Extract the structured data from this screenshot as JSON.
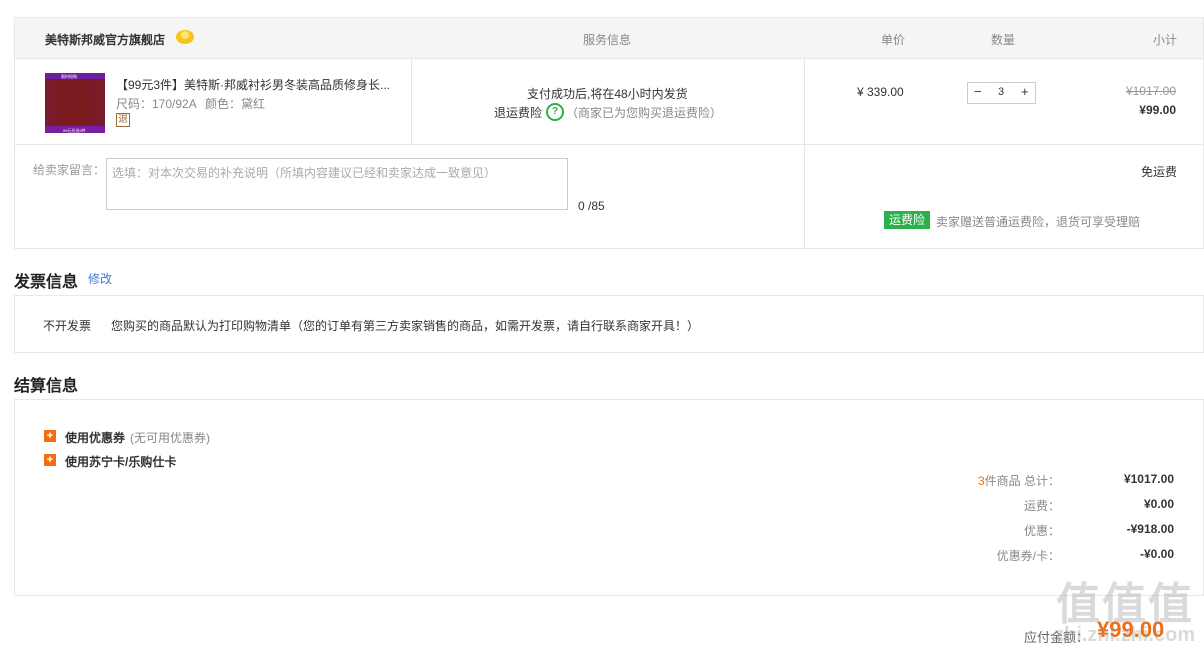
{
  "table_header": {
    "store": "美特斯邦威官方旗舰店",
    "service": "服务信息",
    "unit_price": "单价",
    "quantity": "数量",
    "subtotal": "小计"
  },
  "item": {
    "title": "【99元3件】美特斯·邦威衬衫男冬装高品质修身长...",
    "size": "尺码：170/92A",
    "color": "颜色：黛红",
    "return_tag": "退",
    "thumb_top": "限时抢购",
    "thumb_bottom": "99元任选3件",
    "service_line1": "支付成功后,将在48小时内发货",
    "service_insurance_label": "退运费险",
    "service_insurance_note": "（商家已为您购买退运费险）",
    "unit_price": "¥ 339.00",
    "quantity": "3",
    "original_subtotal": "¥1017.00",
    "subtotal": "¥99.00"
  },
  "message": {
    "label": "给卖家留言：",
    "placeholder": "选填：对本次交易的补充说明（所填内容建议已经和卖家达成一致意见）",
    "counter": "0 /85"
  },
  "shipping": {
    "free": "免运费",
    "badge": "运费险",
    "note": "卖家赠送普通运费险，退货可享受理赔"
  },
  "invoice": {
    "title": "发票信息",
    "edit_link": "修改",
    "type": "不开发票",
    "note": "您购买的商品默认为打印购物清单（您的订单有第三方卖家销售的商品，如需开发票，请自行联系商家开具！）"
  },
  "settlement": {
    "title": "结算信息",
    "coupon_label": "使用优惠券",
    "coupon_note": "(无可用优惠券)",
    "card_label": "使用苏宁卡/乐购仕卡",
    "rows": [
      {
        "count": "3",
        "label": "件商品 总计：",
        "value": "¥1017.00"
      },
      {
        "label": "运费：",
        "value": "¥0.00"
      },
      {
        "label": "优惠：",
        "value": "-¥918.00"
      },
      {
        "label": "优惠券/卡：",
        "value": "-¥0.00"
      }
    ],
    "payable_label": "应付金额：",
    "payable_value": "¥99.00"
  },
  "watermark": {
    "top": "值值值",
    "bottom": "zhi.zhi.zhi.com"
  },
  "colors": {
    "accent": "#f06e14",
    "green": "#2bb04b",
    "link": "#3a7bd5"
  }
}
